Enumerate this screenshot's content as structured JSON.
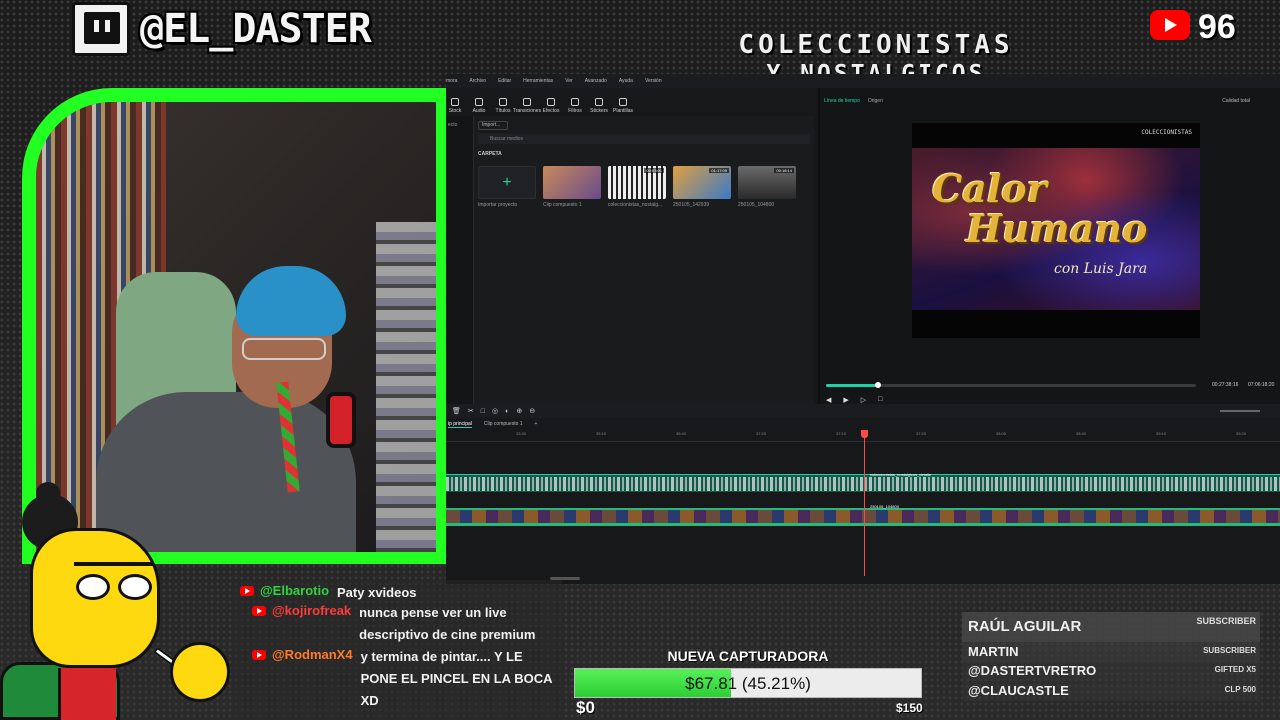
{
  "overlay": {
    "twitch_handle": "@EL_DASTER",
    "youtube_count": "96",
    "brand_line1": "COLECCIONISTAS",
    "brand_line2": "Y NOSTALGICOS"
  },
  "editor": {
    "menu": [
      "mora",
      "Archivo",
      "Editar",
      "Herramientas",
      "Ver",
      "Avanzado",
      "Ayuda",
      "Versión"
    ],
    "toolbar": [
      {
        "label": "Stock",
        "icon": "stock-icon"
      },
      {
        "label": "Audio",
        "icon": "audio-icon"
      },
      {
        "label": "Títulos",
        "icon": "titles-icon"
      },
      {
        "label": "Transiciones",
        "icon": "transitions-icon"
      },
      {
        "label": "Efectos",
        "icon": "effects-icon"
      },
      {
        "label": "Filtros",
        "icon": "filters-icon"
      },
      {
        "label": "Stickers",
        "icon": "stickers-icon"
      },
      {
        "label": "Plantillas",
        "icon": "templates-icon"
      }
    ],
    "media": {
      "side_items": [
        "ecto",
        "",
        "",
        ""
      ],
      "import_label": "Import...",
      "search_placeholder": "Buscar medios",
      "folder_label": "CARPETA",
      "thumbs": [
        {
          "caption": "Importar proyecto",
          "duration": "",
          "color": "#202124",
          "import": true
        },
        {
          "caption": "Clip compuesto 1",
          "duration": "",
          "color": "#6a4a8a"
        },
        {
          "caption": "coleccionistas_nostalg...",
          "duration": "00:03:01",
          "color": "#d8d8d8"
        },
        {
          "caption": "250105_142939",
          "duration": "01:17:09",
          "color": "#3a7ac8"
        },
        {
          "caption": "250105_104800",
          "duration": "00:18:14",
          "color": "#5a5a5a"
        }
      ]
    },
    "preview": {
      "tab_timeline": "Línea de tiempo",
      "tab_source": "Origen",
      "quality": "Calidad total",
      "video_title_line1": "Calor",
      "video_title_line2": "Humano",
      "video_subtitle": "con Luis Jara",
      "watermark": "COLECCIONISTAS",
      "progress": 0.14,
      "time_current": "00:27:38:16",
      "time_total": "07:06:18:20"
    },
    "timeline": {
      "tabs": [
        "ip principal",
        "Clip compuesto 1",
        "+"
      ],
      "ruler": [
        "33:30",
        "35:10",
        "36:40",
        "37:20",
        "37:10",
        "37:20",
        "38:00",
        "38:40",
        "39:10",
        "39:20"
      ],
      "clip_label_1": "coleccionistas_nostalgicos_detalle",
      "clip_label_2": "250105_104800"
    }
  },
  "chat": {
    "messages": [
      {
        "user": "@Elbarotio",
        "color": "green",
        "text": "Paty xvideos"
      },
      {
        "user": "@kojirofreak",
        "color": "red",
        "text": "nunca pense ver un live descriptivo de cine premium"
      },
      {
        "user": "@RodmanX4",
        "color": "orange",
        "text": "y termina de pintar.... Y LE PONE EL PINCEL EN LA BOCA XD"
      }
    ]
  },
  "goal": {
    "title": "NUEVA CAPTURADORA",
    "current": "$67.81",
    "percent_text": "(45.21%)",
    "fraction": 0.4521,
    "min": "$0",
    "max": "$150"
  },
  "supporters": [
    {
      "name": "RAÚL AGUILAR",
      "tag": "SUBSCRIBER"
    },
    {
      "name": "MARTIN",
      "tag": "SUBSCRIBER"
    },
    {
      "name": "@DASTERTVRETRO",
      "tag": "GIFTED X5"
    },
    {
      "name": "@CLAUCASTLE",
      "tag": "CLP 500"
    }
  ],
  "colors": {
    "accent": "#1fd2a4",
    "cam_border": "#22ff22",
    "goal_fill": "#2ccf33",
    "youtube": "#ff0000"
  }
}
